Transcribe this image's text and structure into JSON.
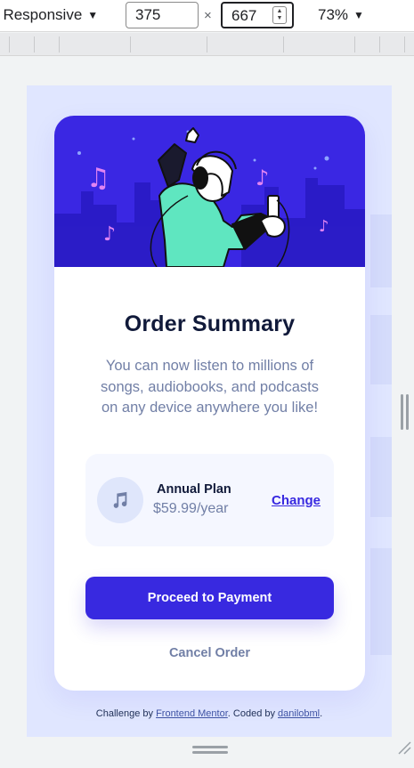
{
  "devtools": {
    "device_label": "Responsive",
    "width_value": "375",
    "height_value": "667",
    "times_symbol": "×",
    "zoom_label": "73%"
  },
  "hero": {
    "icon_name": "music-person-illustration"
  },
  "summary": {
    "title": "Order Summary",
    "description": "You can now listen to millions of songs, audiobooks, and podcasts on any device anywhere you like!"
  },
  "plan": {
    "icon_name": "music-note-icon",
    "name": "Annual Plan",
    "price": "$59.99/year",
    "change_label": "Change"
  },
  "actions": {
    "proceed_label": "Proceed to Payment",
    "cancel_label": "Cancel Order"
  },
  "attribution": {
    "prefix": "Challenge by ",
    "link1": "Frontend Mentor",
    "middle": ". Coded by ",
    "link2": "danilobml",
    "suffix": "."
  },
  "colors": {
    "accent": "#3829e0",
    "page_bg": "#e0e6ff",
    "hero_bg": "#3a27e3",
    "muted_text": "#717fa6"
  }
}
